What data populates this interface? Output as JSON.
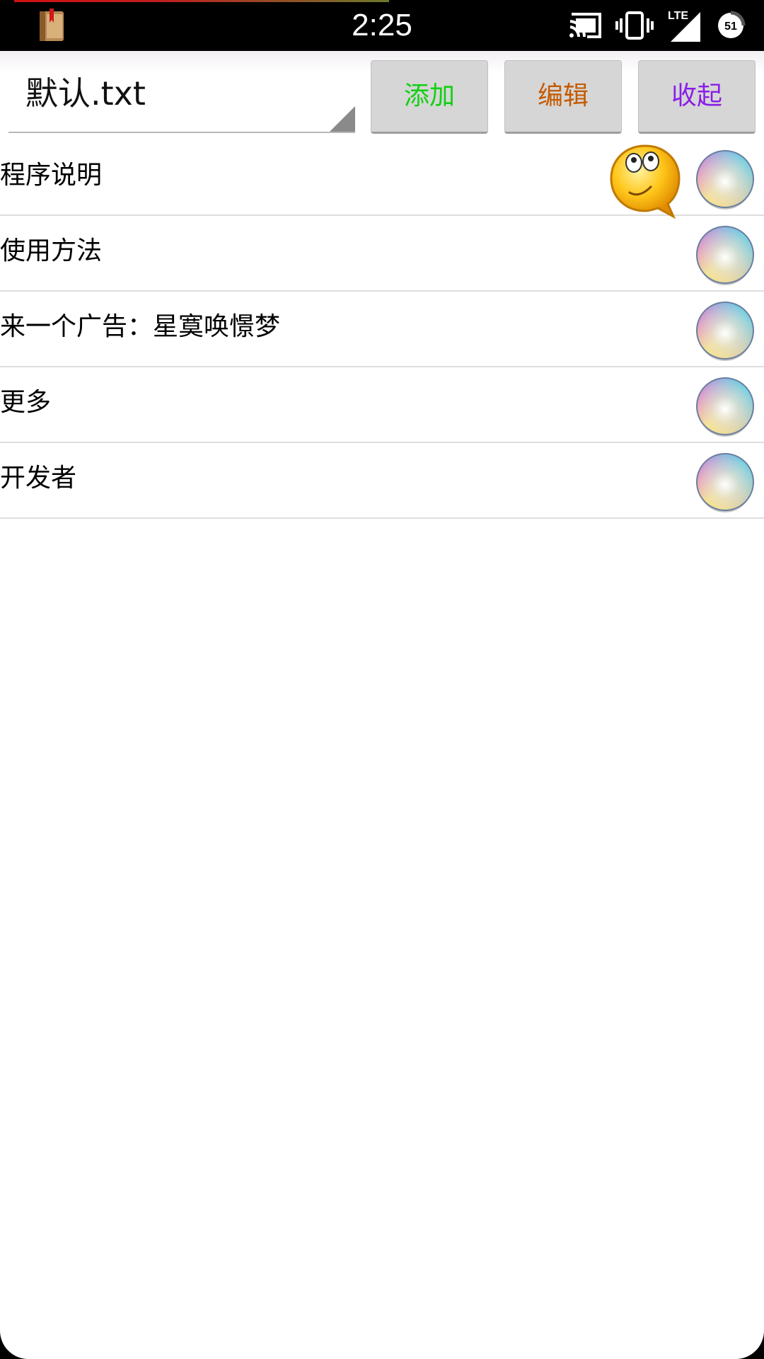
{
  "status_bar": {
    "time": "2:25",
    "network": "LTE",
    "battery": "51",
    "icons": [
      "app-book-icon",
      "cast-icon",
      "vibrate-icon",
      "signal-icon",
      "battery-saver-icon"
    ]
  },
  "toolbar": {
    "file_selected": "默认.txt",
    "add_label": "添加",
    "edit_label": "编辑",
    "collapse_label": "收起",
    "colors": {
      "add": "#12d012",
      "edit": "#c45a00",
      "collapse": "#8a1ee8"
    }
  },
  "list": {
    "items": [
      {
        "label": "程序说明",
        "icons": [
          "thinking-smiley-icon",
          "color-orb-icon"
        ]
      },
      {
        "label": "使用方法",
        "icons": [
          "color-orb-icon"
        ]
      },
      {
        "label": "来一个广告：星寞唤憬梦",
        "icons": [
          "color-orb-icon"
        ]
      },
      {
        "label": "更多",
        "icons": [
          "color-orb-icon"
        ]
      },
      {
        "label": "开发者",
        "icons": [
          "color-orb-icon"
        ]
      }
    ]
  }
}
